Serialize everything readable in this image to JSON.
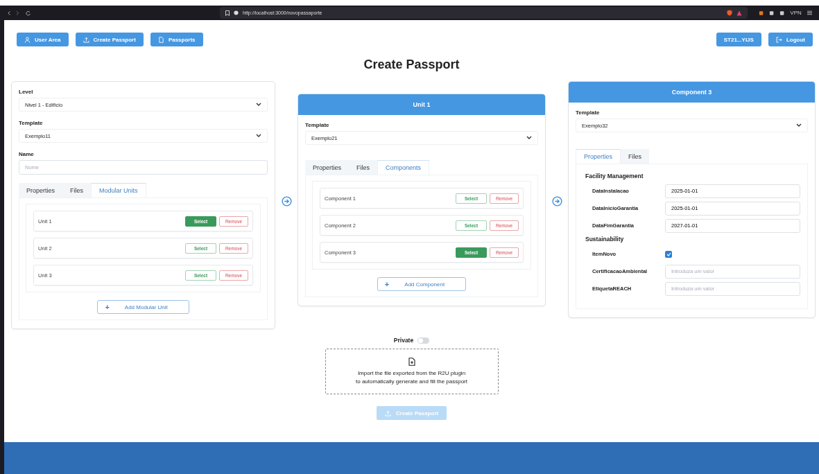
{
  "browser": {
    "url": "http://localhost:3000/novopassaporte",
    "vpn_label": "VPN"
  },
  "nav": {
    "left_buttons": [
      {
        "label": "User Area",
        "kind": "user"
      },
      {
        "label": "Create Passport",
        "kind": "upload"
      },
      {
        "label": "Passports",
        "kind": "file"
      }
    ],
    "right_buttons": [
      {
        "label": "ST21...YIJS",
        "kind": "account"
      },
      {
        "label": "Logout",
        "kind": "logout"
      }
    ]
  },
  "title": "Create Passport",
  "level_panel": {
    "fields": [
      {
        "label": "Level",
        "kind": "select",
        "value": "Nivel 1 - Edifício"
      },
      {
        "label": "Template",
        "kind": "select",
        "value": "Exemplo11"
      },
      {
        "label": "Name",
        "kind": "text",
        "placeholder": "Nome"
      }
    ],
    "tabs": [
      {
        "label": "Properties",
        "selected": false
      },
      {
        "label": "Files",
        "selected": false
      },
      {
        "label": "Modular Units",
        "selected": true
      }
    ],
    "items": [
      {
        "name": "Unit 1",
        "selected": true,
        "select_label": "Select",
        "remove_label": "Remove"
      },
      {
        "name": "Unit 2",
        "selected": false,
        "select_label": "Select",
        "remove_label": "Remove"
      },
      {
        "name": "Unit 3",
        "selected": false,
        "select_label": "Select",
        "remove_label": "Remove"
      }
    ],
    "add_button": {
      "icon": "+",
      "label": "Add Modular Unit"
    }
  },
  "unit_panel": {
    "header": "Unit 1",
    "fields": [
      {
        "label": "Template",
        "kind": "select",
        "value": "Exemplo21"
      }
    ],
    "tabs": [
      {
        "label": "Properties",
        "selected": false
      },
      {
        "label": "Files",
        "selected": false
      },
      {
        "label": "Components",
        "selected": true
      }
    ],
    "items": [
      {
        "name": "Component 1",
        "selected": false,
        "select_label": "Select",
        "remove_label": "Remove"
      },
      {
        "name": "Component 2",
        "selected": false,
        "select_label": "Select",
        "remove_label": "Remove"
      },
      {
        "name": "Component 3",
        "selected": true,
        "select_label": "Select",
        "remove_label": "Remove"
      }
    ],
    "add_button": {
      "icon": "+",
      "label": "Add Component"
    }
  },
  "component_panel": {
    "header": "Component 3",
    "fields": [
      {
        "label": "Template",
        "kind": "select",
        "value": "Exemplo32"
      }
    ],
    "tabs": [
      {
        "label": "Properties",
        "selected": true
      },
      {
        "label": "Files",
        "selected": false
      }
    ],
    "sections": [
      {
        "title": "Facility Management",
        "fields": [
          {
            "label": "DataInstalacao",
            "kind": "text",
            "value": "2025-01-01"
          },
          {
            "label": "DataInicioGarantia",
            "kind": "text",
            "value": "2025-01-01"
          },
          {
            "label": "DataFimGarantia",
            "kind": "text",
            "value": "2027-01-01"
          }
        ]
      },
      {
        "title": "Sustainability",
        "fields": [
          {
            "label": "ItemNovo",
            "kind": "checkbox",
            "checked": true
          },
          {
            "label": "CertificacaoAmbiental",
            "kind": "text",
            "placeholder": "Introduza um valor"
          },
          {
            "label": "EtiquetaREACH",
            "kind": "text",
            "placeholder": "Introduza um valor"
          }
        ]
      }
    ]
  },
  "private": {
    "label": "Private",
    "on": false
  },
  "import": {
    "text": "Import the file exported from the R2U plugin\nto automatically generate and fill the passport"
  },
  "create_button": {
    "label": "Create Passport",
    "disabled": true
  }
}
